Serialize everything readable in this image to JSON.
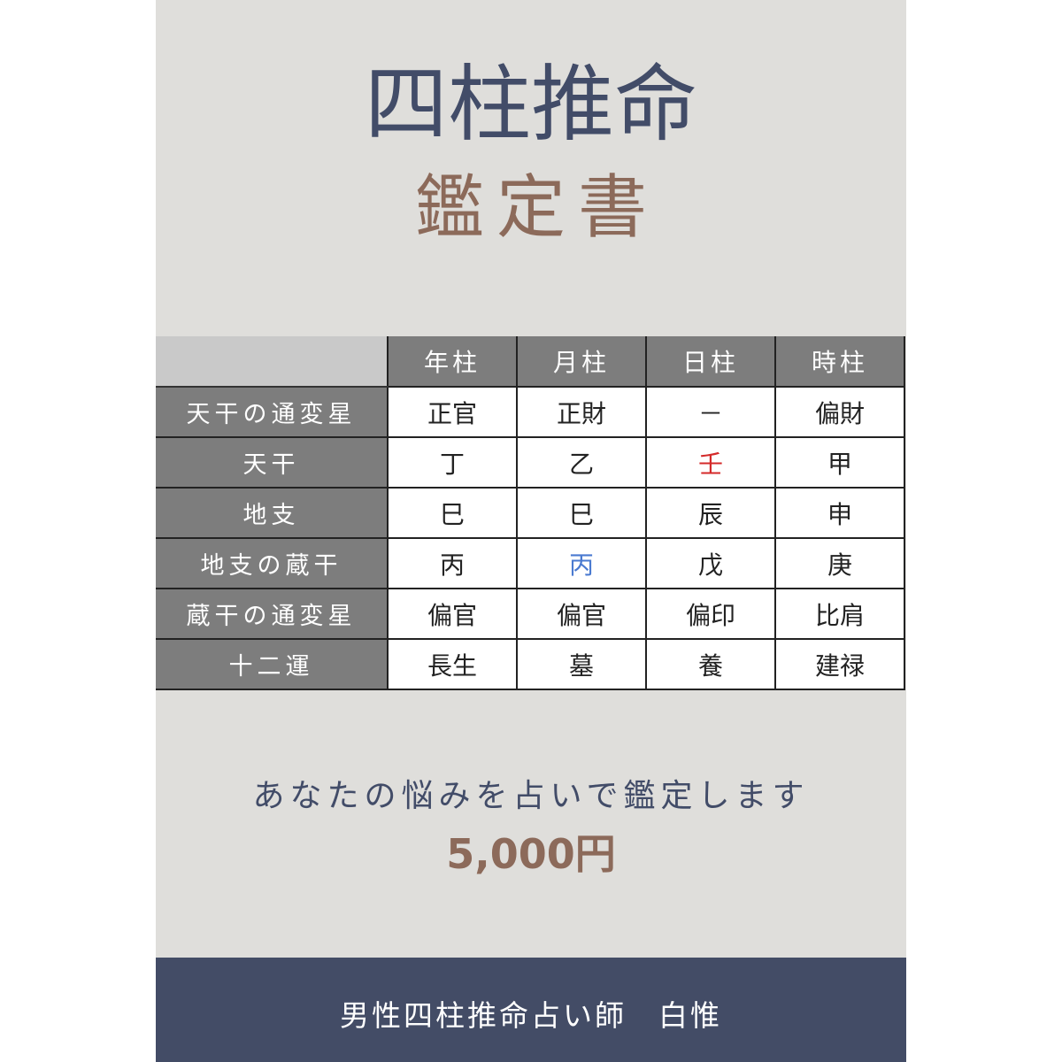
{
  "title": "四柱推命",
  "subtitle": "鑑定書",
  "chart": {
    "columns": [
      "年柱",
      "月柱",
      "日柱",
      "時柱"
    ],
    "rows": [
      {
        "label": "天干の通変星",
        "cells": [
          "正官",
          "正財",
          "－",
          "偏財"
        ]
      },
      {
        "label": "天干",
        "cells": [
          "丁",
          "乙",
          "壬",
          "甲"
        ]
      },
      {
        "label": "地支",
        "cells": [
          "巳",
          "巳",
          "辰",
          "申"
        ]
      },
      {
        "label": "地支の蔵干",
        "cells": [
          "丙",
          "丙",
          "戊",
          "庚"
        ]
      },
      {
        "label": "蔵干の通変星",
        "cells": [
          "偏官",
          "偏官",
          "偏印",
          "比肩"
        ]
      },
      {
        "label": "十二運",
        "cells": [
          "長生",
          "墓",
          "養",
          "建禄"
        ]
      }
    ],
    "highlights": {
      "day_stem_color": "#d42a2a",
      "month_hidden_stem_color": "#4a7ad0"
    }
  },
  "tagline": "あなたの悩みを占いで鑑定します",
  "price": "5,000円",
  "footer": "男性四柱推命占い師　白惟",
  "colors": {
    "background": "#dfdedb",
    "navy": "#434c66",
    "brown": "#8c6a5a",
    "header_gray": "#7d7d7d"
  }
}
